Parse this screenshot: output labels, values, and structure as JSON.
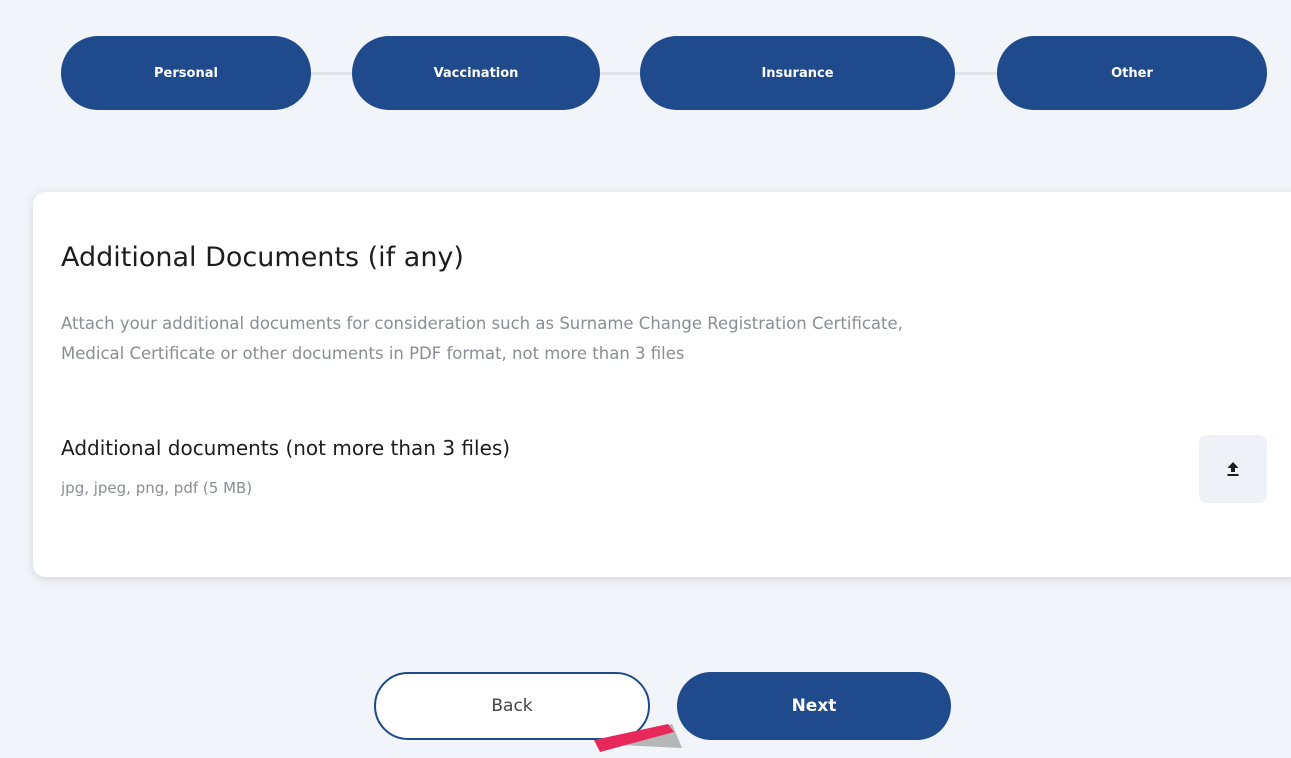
{
  "stepper": {
    "steps": [
      {
        "label": "Personal"
      },
      {
        "label": "Vaccination"
      },
      {
        "label": "Insurance"
      },
      {
        "label": "Other"
      }
    ]
  },
  "section": {
    "title": "Additional Documents (if any)",
    "description_line1": "Attach your additional documents for consideration such as Surname Change Registration Certificate,",
    "description_line2": "Medical Certificate or other documents in PDF format, not more than 3 files",
    "upload": {
      "label": "Additional documents (not more than 3 files)",
      "hint": "jpg, jpeg, png, pdf (5 MB)",
      "icon": "upload-icon"
    }
  },
  "actions": {
    "back_label": "Back",
    "next_label": "Next"
  },
  "colors": {
    "primary": "#1f4a8c",
    "background": "#f1f4f8",
    "muted_text": "#8a8d93"
  }
}
